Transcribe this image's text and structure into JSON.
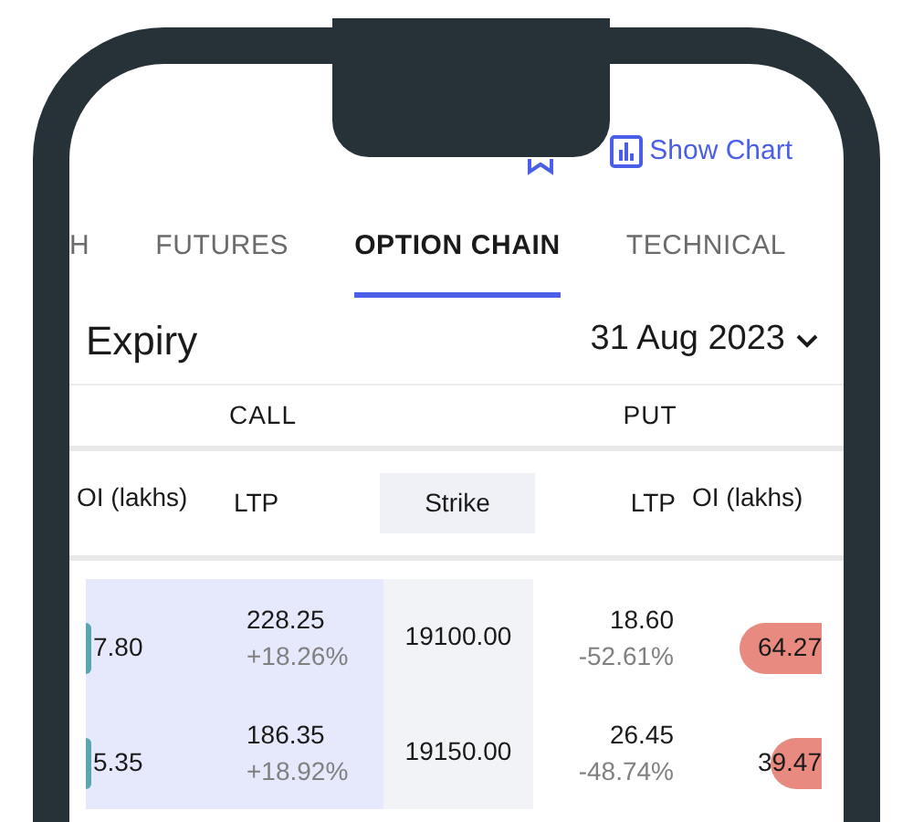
{
  "header": {
    "show_chart": "Show Chart"
  },
  "tabs": [
    {
      "label": "H",
      "selected": false
    },
    {
      "label": "FUTURES",
      "selected": false
    },
    {
      "label": "OPTION CHAIN",
      "selected": true
    },
    {
      "label": "TECHNICAL",
      "selected": false
    }
  ],
  "expiry": {
    "label": "Expiry",
    "date": "31 Aug 2023"
  },
  "sides": [
    "CALL",
    "PUT"
  ],
  "columns": [
    "OI (lakhs)",
    "LTP",
    "Strike",
    "LTP",
    "OI (lakhs)"
  ],
  "rows": [
    {
      "call_oi": "7.80",
      "call_ltp": "228.25",
      "call_change": "+18.26%",
      "strike": "19100.00",
      "put_ltp": "18.60",
      "put_change": "-52.61%",
      "put_oi": "64.27"
    },
    {
      "call_oi": "5.35",
      "call_ltp": "186.35",
      "call_change": "+18.92%",
      "strike": "19150.00",
      "put_ltp": "26.45",
      "put_change": "-48.74%",
      "put_oi": "39.47"
    }
  ]
}
